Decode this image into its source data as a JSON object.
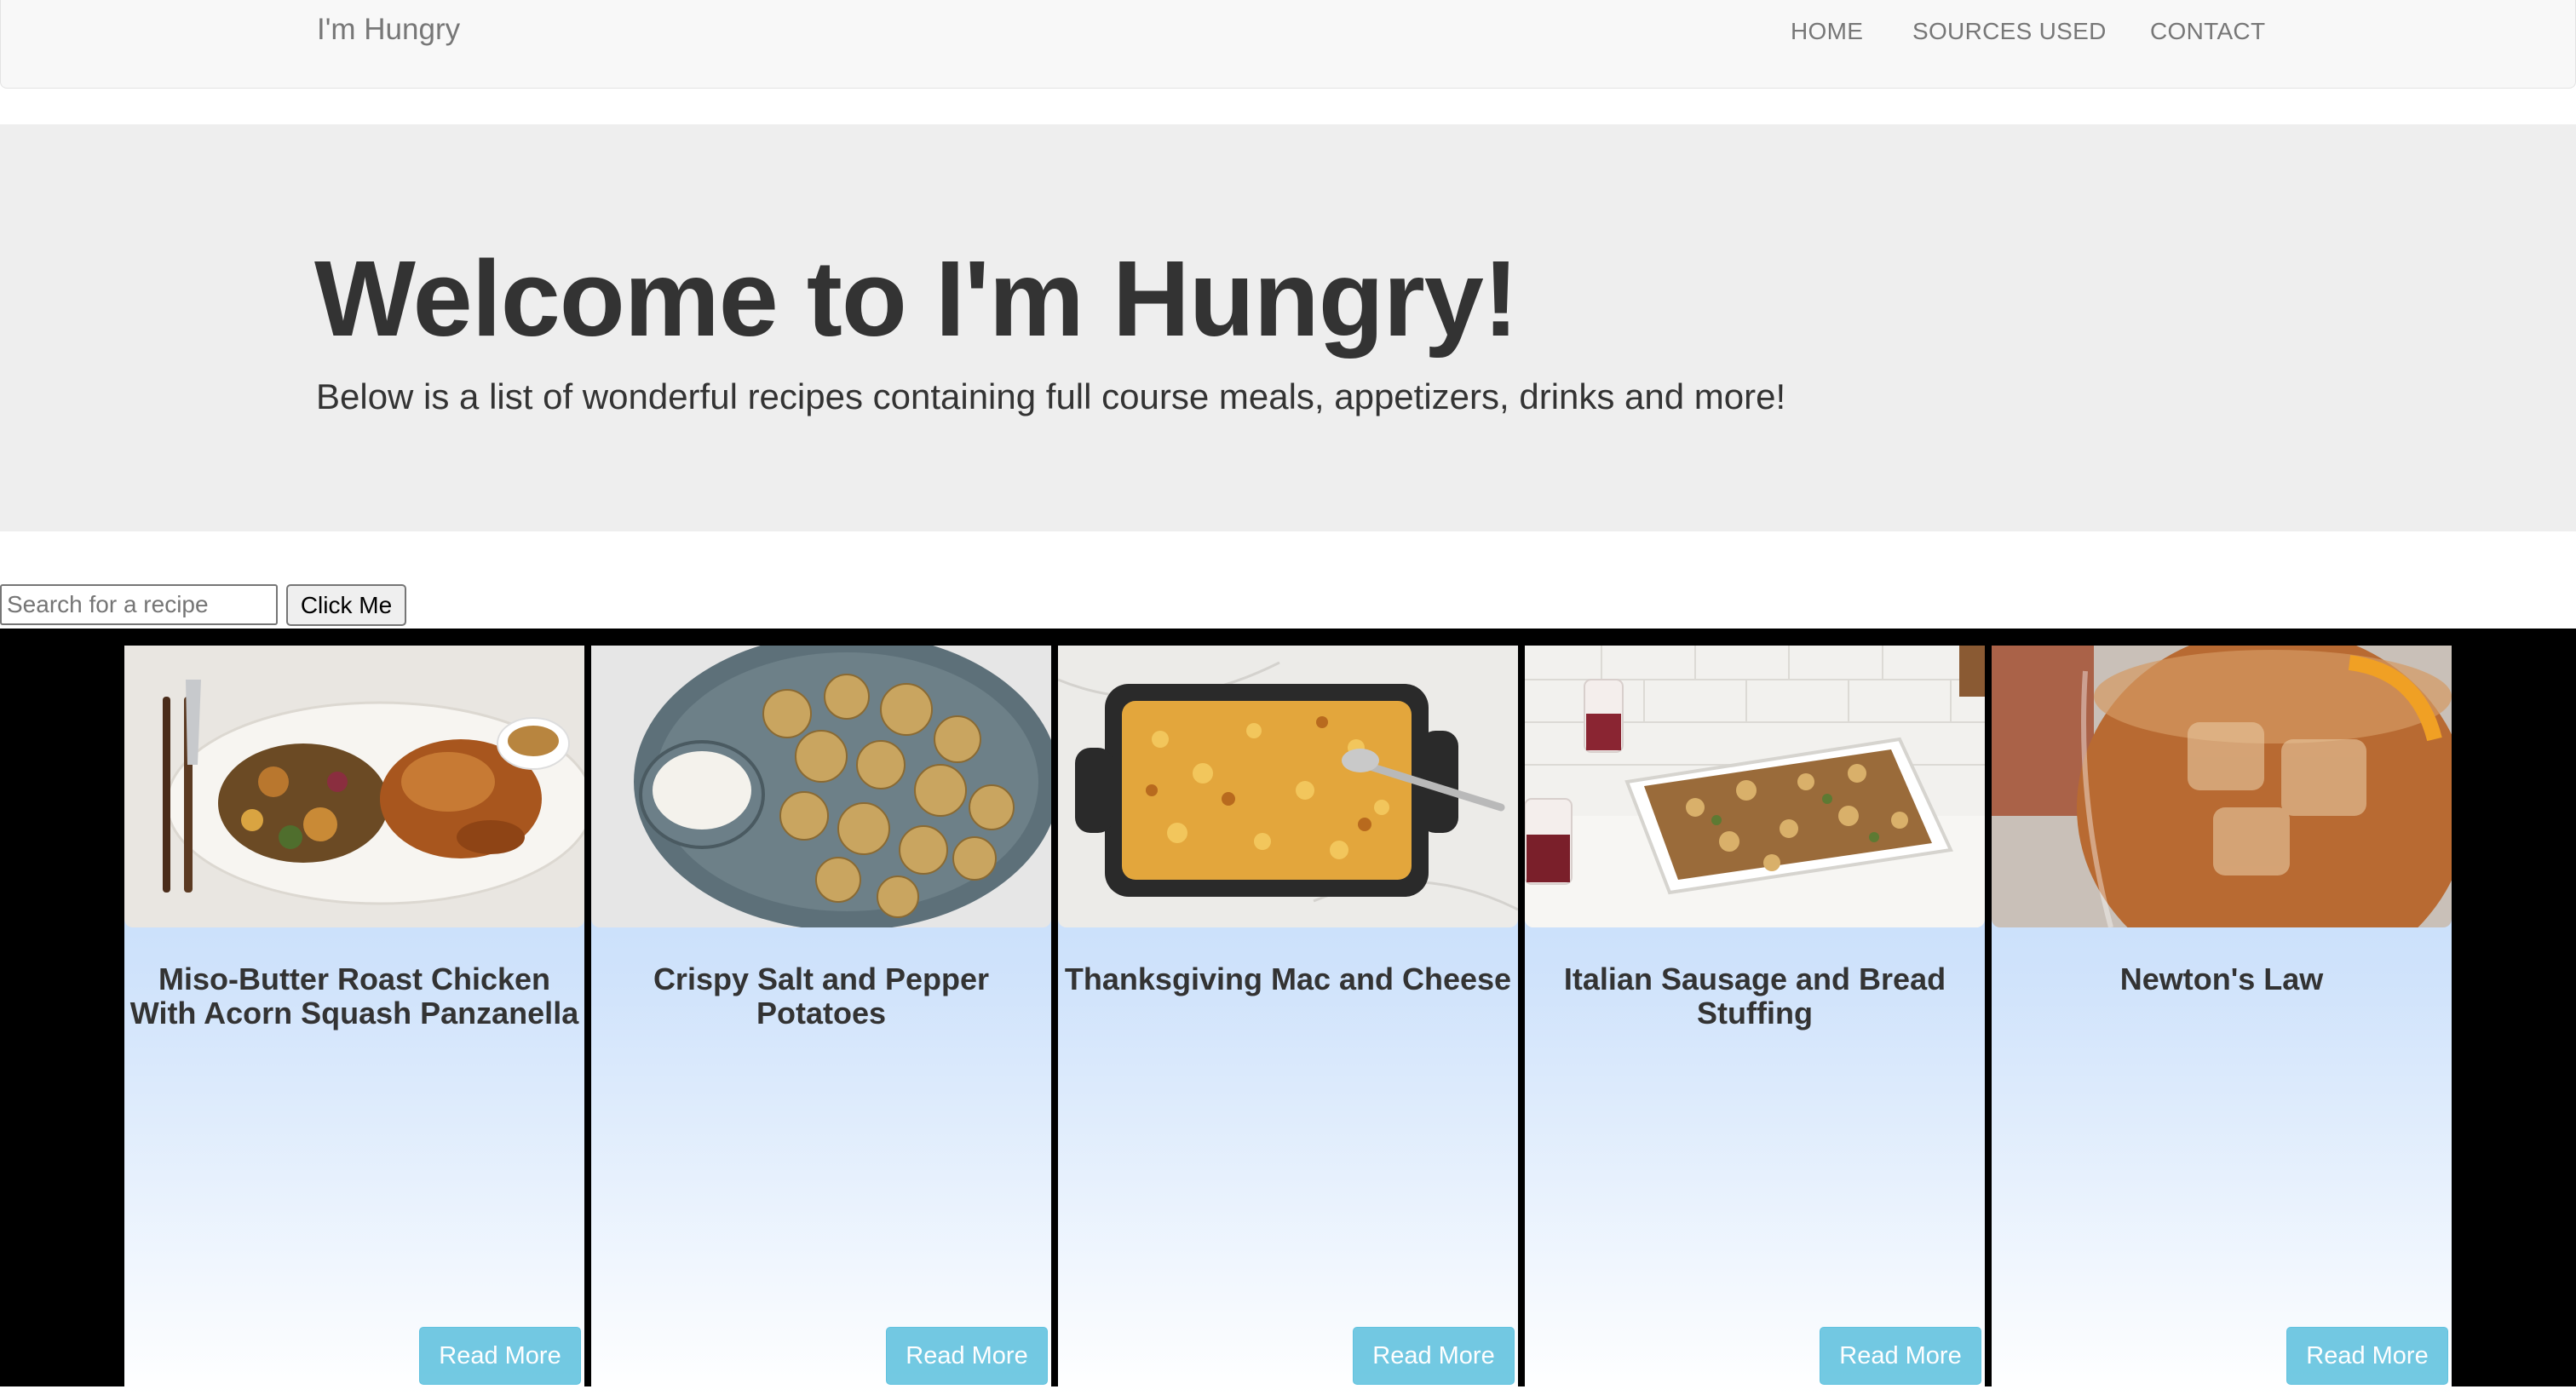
{
  "navbar": {
    "brand": "I'm Hungry",
    "links": [
      "HOME",
      "SOURCES USED",
      "CONTACT"
    ]
  },
  "jumbotron": {
    "title": "Welcome to I'm Hungry!",
    "subtitle": "Below is a list of wonderful recipes containing full course meals, appetizers, drinks and more!"
  },
  "search": {
    "placeholder": "Search for a recipe",
    "button_label": "Click Me"
  },
  "recipes": [
    {
      "title": "Miso-Butter Roast Chicken With Acorn Squash Panzanella",
      "button_label": "Read More",
      "image": "roast-chicken-photo"
    },
    {
      "title": "Crispy Salt and Pepper Potatoes",
      "button_label": "Read More",
      "image": "potatoes-photo"
    },
    {
      "title": "Thanksgiving Mac and Cheese",
      "button_label": "Read More",
      "image": "mac-and-cheese-photo"
    },
    {
      "title": "Italian Sausage and Bread Stuffing",
      "button_label": "Read More",
      "image": "stuffing-photo"
    },
    {
      "title": "Newton's Law",
      "button_label": "Read More",
      "image": "iced-drink-photo"
    }
  ],
  "colors": {
    "navbar_bg": "#f8f8f8",
    "jumbotron_bg": "#eeeeee",
    "card_gradient_top": "#b7d6fb",
    "read_more_button": "#5bc0de",
    "recipes_bg": "#000000"
  }
}
